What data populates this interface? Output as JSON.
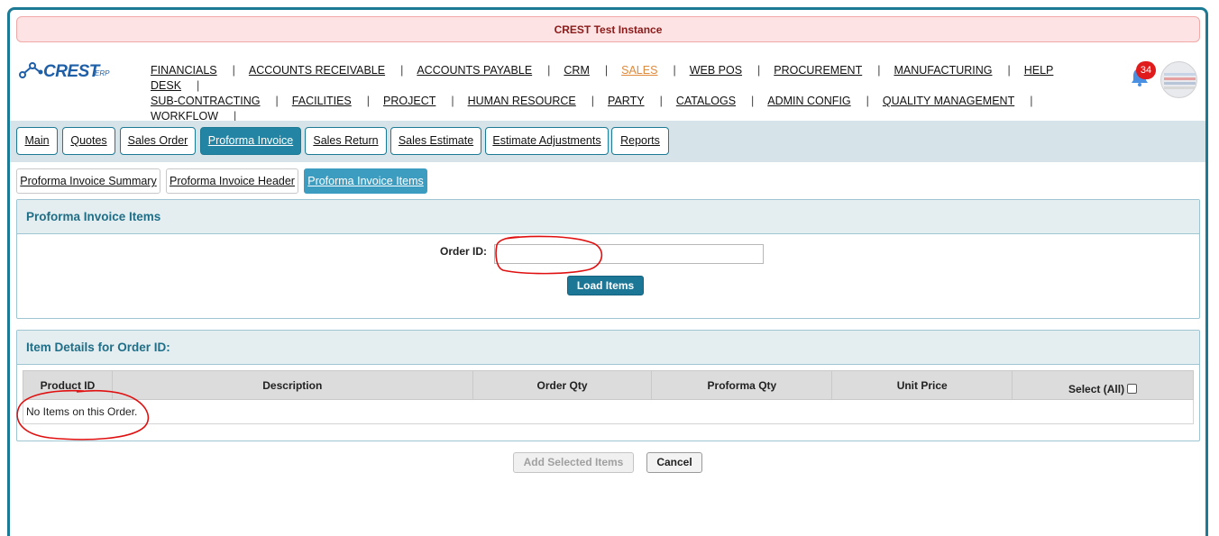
{
  "banner": {
    "text": "CREST Test Instance"
  },
  "logo": {
    "text": "CREST",
    "sub": "ERP"
  },
  "nav": {
    "items": [
      {
        "label": "FINANCIALS"
      },
      {
        "label": "ACCOUNTS RECEIVABLE"
      },
      {
        "label": "ACCOUNTS PAYABLE"
      },
      {
        "label": "CRM"
      },
      {
        "label": "SALES",
        "active": true
      },
      {
        "label": "WEB POS"
      },
      {
        "label": "PROCUREMENT"
      },
      {
        "label": "MANUFACTURING"
      },
      {
        "label": "HELP DESK"
      },
      {
        "label": "SUB-CONTRACTING"
      },
      {
        "label": "FACILITIES"
      },
      {
        "label": "PROJECT"
      },
      {
        "label": "HUMAN RESOURCE"
      },
      {
        "label": "PARTY"
      },
      {
        "label": "CATALOGS"
      },
      {
        "label": "ADMIN CONFIG"
      },
      {
        "label": "QUALITY MANAGEMENT"
      },
      {
        "label": "WORKFLOW"
      }
    ],
    "active_color": "#e08a3c"
  },
  "notifications": {
    "count": "34",
    "icon": "bell-icon",
    "badge_color": "#e01b1b"
  },
  "tabs": [
    {
      "label": "Main"
    },
    {
      "label": "Quotes"
    },
    {
      "label": "Sales Order"
    },
    {
      "label": "Proforma Invoice",
      "active": true
    },
    {
      "label": "Sales Return"
    },
    {
      "label": "Sales Estimate"
    },
    {
      "label": "Estimate Adjustments"
    },
    {
      "label": "Reports"
    }
  ],
  "subtabs": [
    {
      "label": "Proforma Invoice Summary"
    },
    {
      "label": "Proforma Invoice Header"
    },
    {
      "label": "Proforma Invoice Items",
      "active": true
    }
  ],
  "items_panel": {
    "title": "Proforma Invoice Items",
    "order_label": "Order ID:",
    "order_value": "",
    "load_button": "Load Items"
  },
  "details_panel": {
    "title": "Item Details for Order ID:",
    "columns": [
      "Product ID",
      "Description",
      "Order Qty",
      "Proforma Qty",
      "Unit Price",
      "Select (All)"
    ],
    "empty_message": "No Items on this Order."
  },
  "actions": {
    "add_selected": "Add Selected Items",
    "cancel": "Cancel"
  },
  "colors": {
    "accent": "#1d7a94",
    "tab_active": "#2385a3",
    "subtab_active": "#3d9dc0",
    "annotation": "#e01010"
  }
}
